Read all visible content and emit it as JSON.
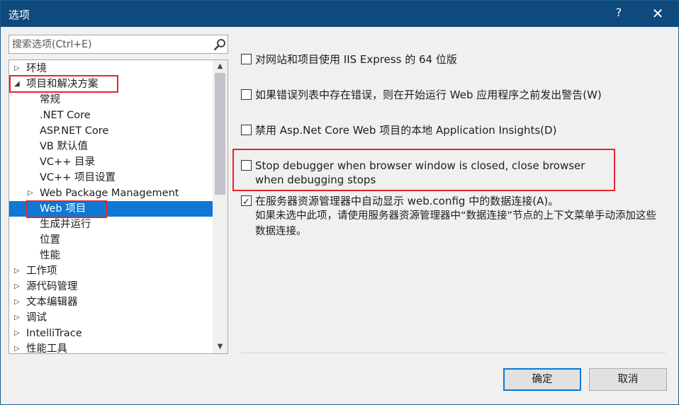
{
  "window": {
    "title": "选项",
    "help": "?",
    "close": "✕"
  },
  "search": {
    "placeholder": "搜索选项(Ctrl+E)"
  },
  "tree": {
    "items": [
      {
        "label": "环境",
        "expander": "▷"
      },
      {
        "label": "项目和解决方案",
        "expander": "◢"
      },
      {
        "label": "常规",
        "expander": ""
      },
      {
        "label": ".NET Core",
        "expander": ""
      },
      {
        "label": "ASP.NET Core",
        "expander": ""
      },
      {
        "label": "VB 默认值",
        "expander": ""
      },
      {
        "label": "VC++ 目录",
        "expander": ""
      },
      {
        "label": "VC++ 项目设置",
        "expander": ""
      },
      {
        "label": "Web Package Management",
        "expander": "▷"
      },
      {
        "label": "Web 项目",
        "expander": ""
      },
      {
        "label": "生成并运行",
        "expander": ""
      },
      {
        "label": "位置",
        "expander": ""
      },
      {
        "label": "性能",
        "expander": ""
      },
      {
        "label": "工作项",
        "expander": "▷"
      },
      {
        "label": "源代码管理",
        "expander": "▷"
      },
      {
        "label": "文本编辑器",
        "expander": "▷"
      },
      {
        "label": "调试",
        "expander": "▷"
      },
      {
        "label": "IntelliTrace",
        "expander": "▷"
      },
      {
        "label": "性能工具",
        "expander": "▷"
      }
    ],
    "selected_index": 9,
    "scroll_up": "▲",
    "scroll_down": "▼"
  },
  "options": [
    {
      "text": "对网站和项目使用 IIS Express 的 64 位版",
      "checked": false
    },
    {
      "text": "如果错误列表中存在错误，则在开始运行 Web 应用程序之前发出警告(W)",
      "checked": false
    },
    {
      "text": "禁用 Asp.Net Core Web 项目的本地 Application Insights(D)",
      "checked": false
    },
    {
      "text": "Stop debugger when browser window is closed, close browser when debugging stops",
      "checked": false
    },
    {
      "text": "在服务器资源管理器中自动显示 web.config 中的数据连接(A)。",
      "checked": true
    }
  ],
  "option_description": "如果未选中此项，请使用服务器资源管理器中“数据连接”节点的上下文菜单手动添加这些数据连接。",
  "buttons": {
    "ok": "确定",
    "cancel": "取消"
  },
  "check_mark": "✓",
  "colors": {
    "titlebar": "#0f4a7c",
    "selection": "#0e78d4",
    "highlight": "#e8242d"
  }
}
